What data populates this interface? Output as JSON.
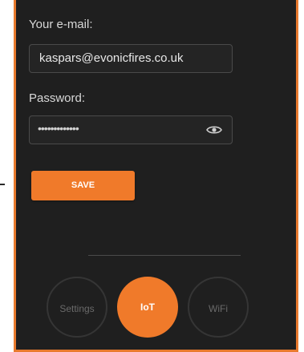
{
  "form": {
    "email_label": "Your e-mail:",
    "email_value": "kaspars@evonicfires.co.uk",
    "password_label": "Password:",
    "password_mask": "•••••••••••••",
    "save_label": "SAVE"
  },
  "modes": [
    {
      "label": "Settings",
      "active": false
    },
    {
      "label": "IoT",
      "active": true
    },
    {
      "label": "WiFi",
      "active": false
    }
  ],
  "colors": {
    "accent": "#f07a2a",
    "background": "#1f1f1f",
    "border": "#e87a2e"
  }
}
